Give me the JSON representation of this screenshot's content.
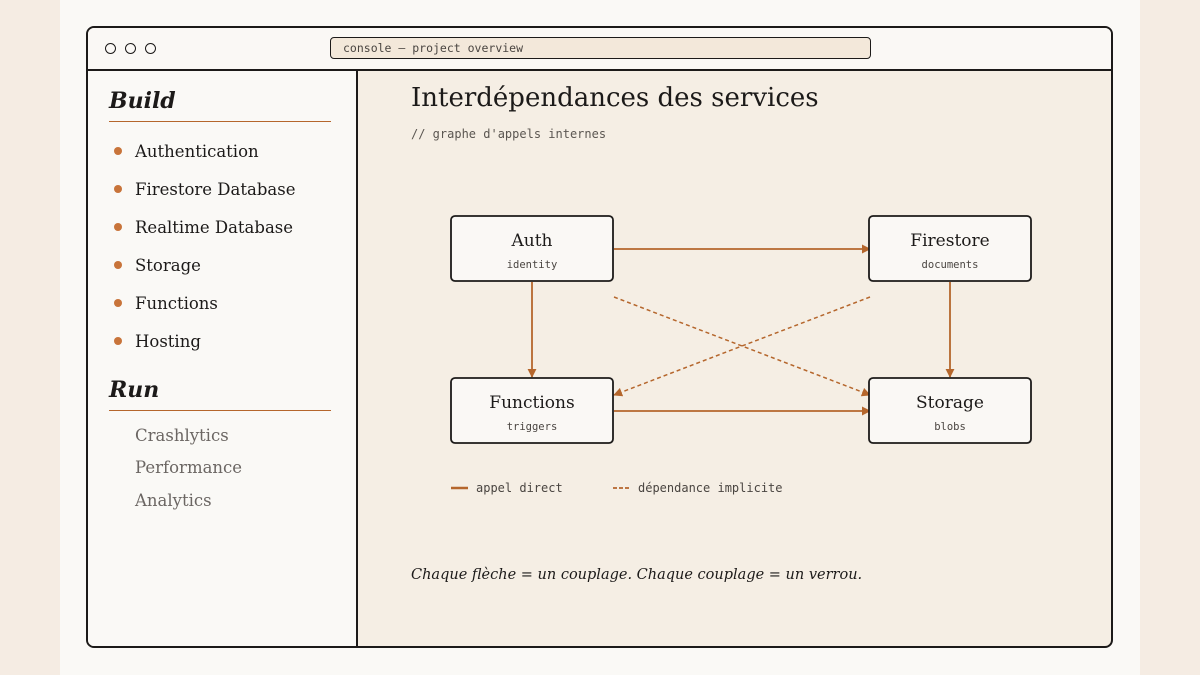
{
  "window": {
    "url": "console — project overview"
  },
  "sidebar": {
    "build_title": "Build",
    "build_items": [
      {
        "label": "Authentication"
      },
      {
        "label": "Firestore Database"
      },
      {
        "label": "Realtime Database"
      },
      {
        "label": "Storage"
      },
      {
        "label": "Functions"
      },
      {
        "label": "Hosting"
      }
    ],
    "run_title": "Run",
    "run_items": [
      {
        "label": "Crashlytics"
      },
      {
        "label": "Performance"
      },
      {
        "label": "Analytics"
      }
    ]
  },
  "main": {
    "title": "Interdépendances des services",
    "subtitle": "// graphe d'appels internes",
    "footer_note": "Chaque flèche = un couplage. Chaque couplage = un verrou."
  },
  "diagram": {
    "nodes": [
      {
        "id": "auth",
        "label": "Auth",
        "sub": "identity"
      },
      {
        "id": "firestore",
        "label": "Firestore",
        "sub": "documents"
      },
      {
        "id": "functions",
        "label": "Functions",
        "sub": "triggers"
      },
      {
        "id": "storage",
        "label": "Storage",
        "sub": "blobs"
      }
    ],
    "edges": [
      {
        "from": "auth",
        "to": "firestore",
        "kind": "direct"
      },
      {
        "from": "auth",
        "to": "functions",
        "kind": "direct"
      },
      {
        "from": "firestore",
        "to": "storage",
        "kind": "direct"
      },
      {
        "from": "functions",
        "to": "storage",
        "kind": "direct"
      },
      {
        "from": "auth",
        "to": "storage",
        "kind": "implicit"
      },
      {
        "from": "firestore",
        "to": "functions",
        "kind": "implicit"
      }
    ],
    "legend": {
      "direct": "appel direct",
      "implicit": "dépendance implicite"
    }
  },
  "colors": {
    "accent": "#b5662c",
    "ink": "#1c1a19",
    "panel": "#f5eee4",
    "sidebar": "#faf9f6"
  }
}
